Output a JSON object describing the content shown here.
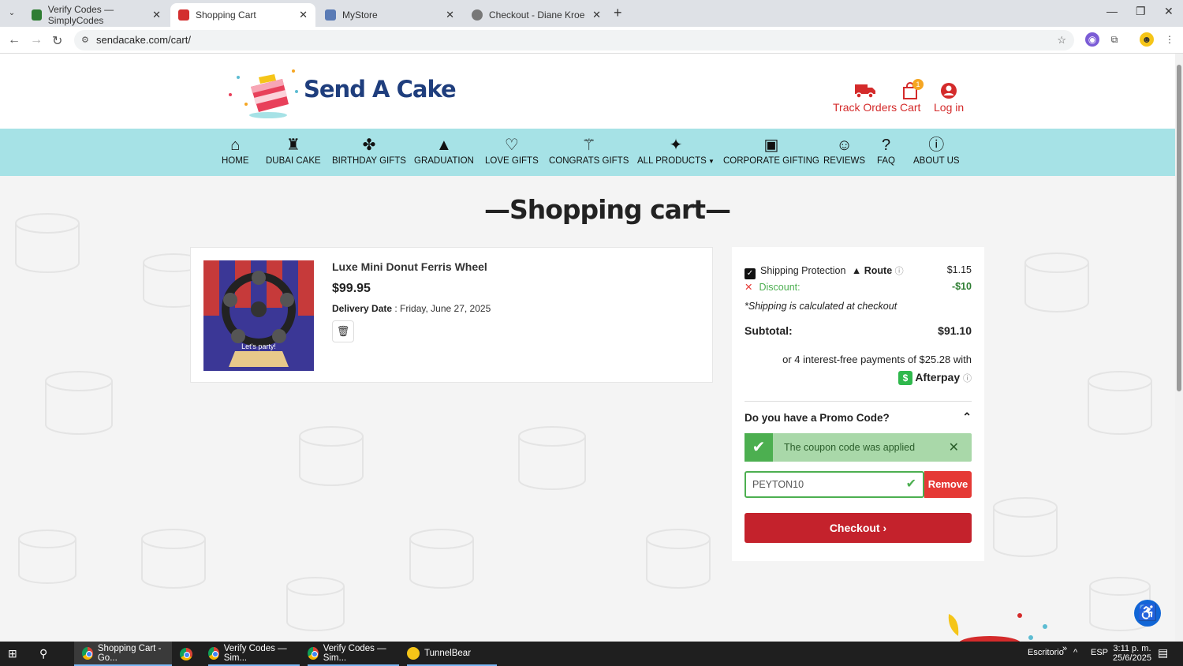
{
  "browser": {
    "tabs": [
      {
        "title": "Verify Codes — SimplyCodes",
        "color": "#2e7d32"
      },
      {
        "title": "Shopping Cart",
        "color": "#d32f2f"
      },
      {
        "title": "MyStore",
        "color": "#5a7bb5"
      },
      {
        "title": "Checkout - Diane Kroe",
        "color": "#777777"
      }
    ],
    "url": "sendacake.com/cart/"
  },
  "header": {
    "logo": "Send A Cake",
    "links": {
      "track": "Track Orders",
      "cart": "Cart",
      "login": "Log in"
    },
    "cart_count": "1"
  },
  "nav": {
    "items": [
      "HOME",
      "DUBAI CAKE",
      "BIRTHDAY GIFTS",
      "GRADUATION",
      "LOVE GIFTS",
      "CONGRATS GIFTS",
      "ALL PRODUCTS",
      "CORPORATE GIFTING",
      "REVIEWS",
      "FAQ",
      "ABOUT US"
    ]
  },
  "cart": {
    "title": "Shopping cart",
    "item": {
      "name": "Luxe Mini Donut Ferris Wheel",
      "price": "$99.95",
      "delivery_label": "Delivery Date",
      "delivery_value": ": Friday, June 27, 2025",
      "image_text": "Let's party!"
    }
  },
  "summary": {
    "shipping_protection": "Shipping Protection",
    "route": "Route",
    "shipping_protection_value": "$1.15",
    "discount_label": "Discount:",
    "discount_value": "-$10",
    "shipping_note": "*Shipping is calculated at checkout",
    "subtotal_label": "Subtotal:",
    "subtotal_value": "$91.10",
    "afterpay_text": "or 4 interest-free payments of $25.28 with",
    "afterpay_brand": "Afterpay",
    "promo_question": "Do you have a Promo Code?",
    "coupon_message": "The coupon code was applied",
    "promo_code": "PEYTON10",
    "remove_label": "Remove",
    "checkout_label": "Checkout"
  },
  "taskbar": {
    "items": [
      "Shopping Cart - Go...",
      "Verify Codes — Sim...",
      "Verify Codes — Sim...",
      "TunnelBear"
    ],
    "desktop": "Escritorio",
    "lang": "ESP",
    "time": "3:11 p. m.",
    "date": "25/6/2025"
  }
}
